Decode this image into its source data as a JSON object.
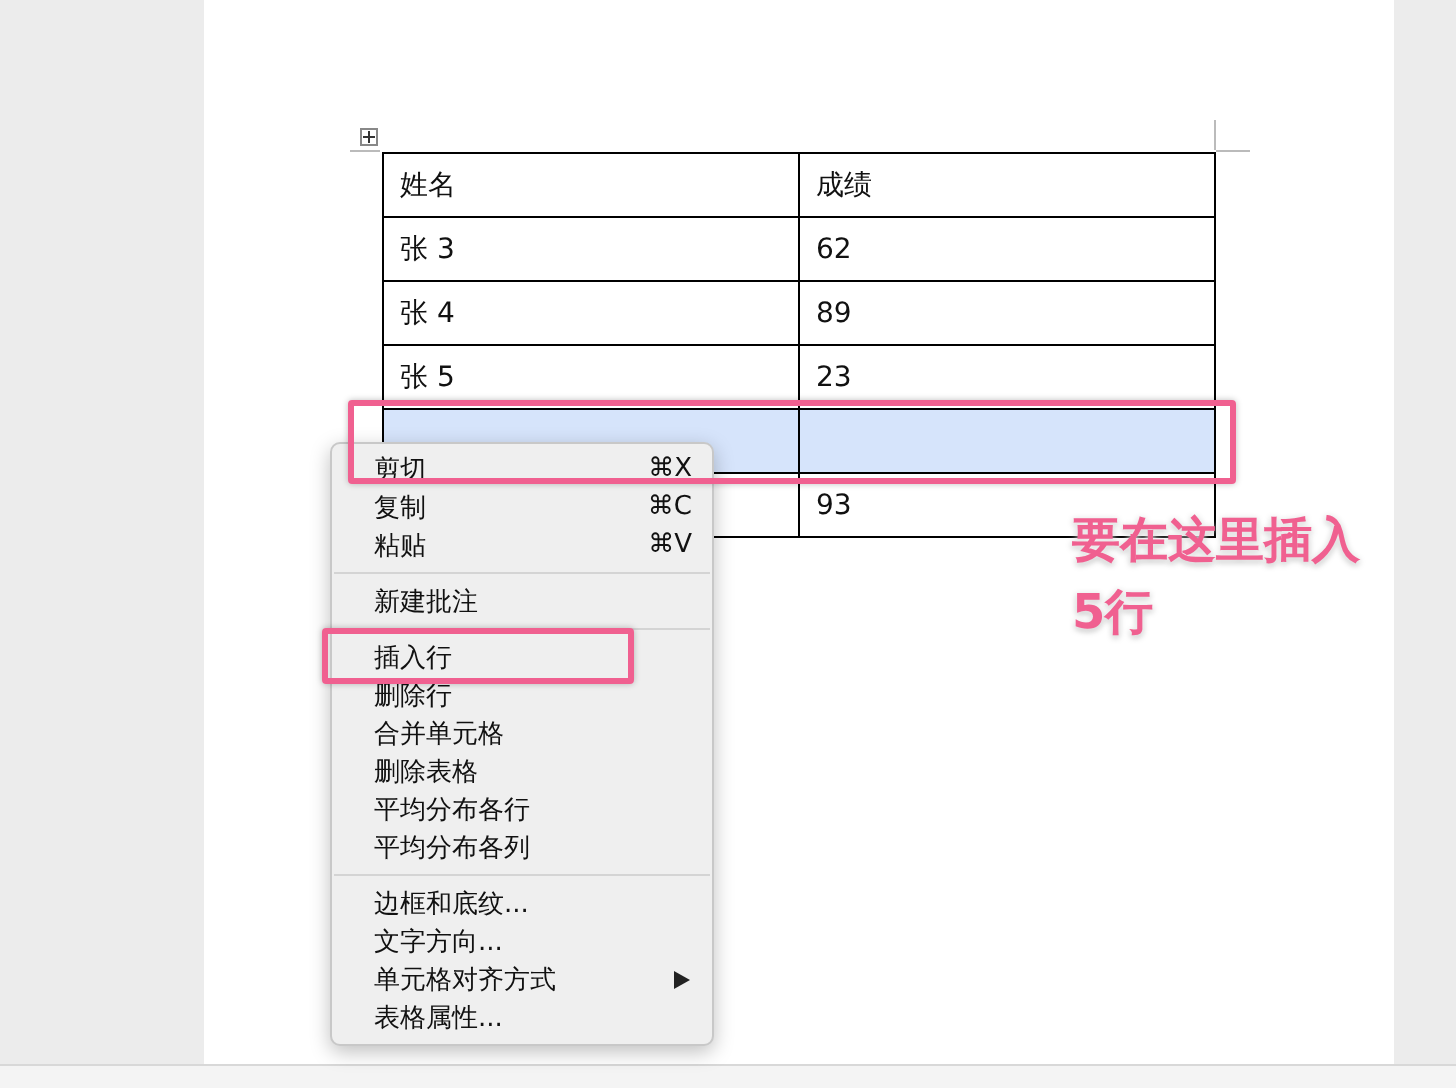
{
  "table": {
    "columns": [
      "姓名",
      "成绩"
    ],
    "rows": [
      {
        "name": "张 3",
        "score": "62",
        "selected": false
      },
      {
        "name": "张 4",
        "score": "89",
        "selected": false
      },
      {
        "name": "张 5",
        "score": "23",
        "selected": false
      },
      {
        "selected": true
      },
      {
        "score": "93",
        "selected": false
      }
    ]
  },
  "context_menu": {
    "groups": [
      [
        {
          "label": "剪切",
          "shortcut": "⌘X",
          "submenu": false
        },
        {
          "label": "复制",
          "shortcut": "⌘C",
          "submenu": false
        },
        {
          "label": "粘贴",
          "shortcut": "⌘V",
          "submenu": false
        }
      ],
      [
        {
          "label": "新建批注",
          "submenu": false
        }
      ],
      [
        {
          "label": "插入行",
          "submenu": false
        },
        {
          "label": "删除行",
          "submenu": false
        },
        {
          "label": "合并单元格",
          "submenu": false
        },
        {
          "label": "删除表格",
          "submenu": false
        },
        {
          "label": "平均分布各行",
          "submenu": false
        },
        {
          "label": "平均分布各列",
          "submenu": false
        }
      ],
      [
        {
          "label": "边框和底纹...",
          "submenu": false
        },
        {
          "label": "文字方向...",
          "submenu": false
        },
        {
          "label": "单元格对齐方式",
          "submenu": true
        },
        {
          "label": "表格属性...",
          "submenu": false
        }
      ]
    ]
  },
  "annotation": {
    "text": "要在这里插入5行"
  }
}
